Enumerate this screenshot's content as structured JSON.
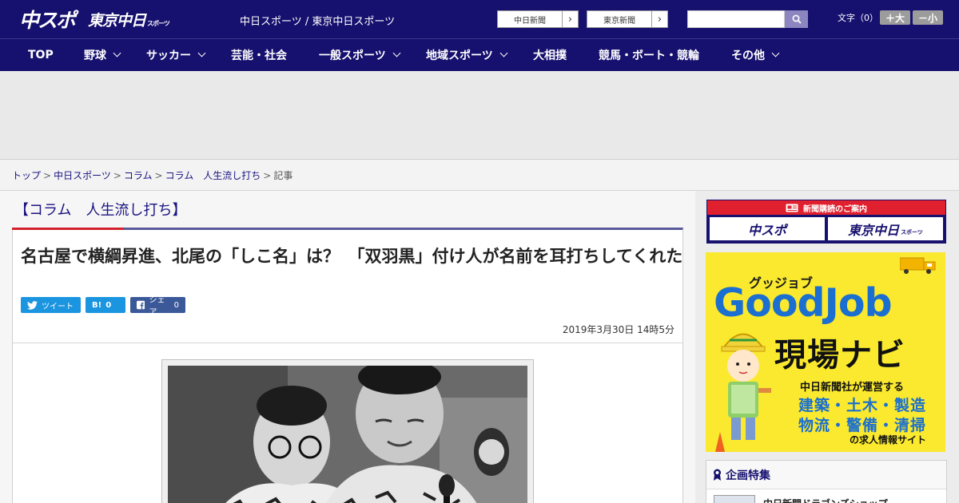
{
  "header": {
    "logo_main": "中スポ",
    "logo_tokyo": "東京中日",
    "logo_tokyo_small": "スポーツ",
    "site_title": "中日スポーツ / 東京中日スポーツ",
    "links": [
      {
        "label": "中日新聞"
      },
      {
        "label": "東京新聞"
      }
    ],
    "search": {
      "placeholder": ""
    },
    "font_size_label": "文字（0）",
    "font_large": "＋大",
    "font_small": "－小"
  },
  "nav": {
    "items": [
      {
        "label": "TOP",
        "has_menu": false
      },
      {
        "label": "野球",
        "has_menu": true
      },
      {
        "label": "サッカー",
        "has_menu": true
      },
      {
        "label": "芸能・社会",
        "has_menu": false
      },
      {
        "label": "一般スポーツ",
        "has_menu": true
      },
      {
        "label": "地域スポーツ",
        "has_menu": true
      },
      {
        "label": "大相撲",
        "has_menu": false
      },
      {
        "label": "競馬・ボート・競輪",
        "has_menu": false
      },
      {
        "label": "その他",
        "has_menu": true
      }
    ]
  },
  "breadcrumb": {
    "items": [
      "トップ",
      "中日スポーツ",
      "コラム",
      "コラム　人生流し打ち"
    ],
    "current": "記事",
    "separator": ">"
  },
  "article": {
    "column_label": "【コラム　人生流し打ち】",
    "headline": "名古屋で横綱昇進、北尾の「しこ名」は？　「双羽黒」付け人が名前を耳打ちしてくれた",
    "share": {
      "tweet_label": "ツイート",
      "hatena_label": "B!",
      "hatena_count": "0",
      "facebook_label": "シェア",
      "facebook_count": "0"
    },
    "date": "2019年3月30日 14時5分"
  },
  "sidebar": {
    "promo_heading": "新聞購読のご案内",
    "promo_logos": [
      {
        "label": "中スポ",
        "small": ""
      },
      {
        "label": "東京中日",
        "small": "スポーツ"
      }
    ],
    "goodjob": {
      "kana": "グッジョブ",
      "title": "GoodJob",
      "subtitle": "現場ナビ",
      "description": "中日新聞社が運営する",
      "categories_1": "建築・土木・製造",
      "categories_2": "物流・警備・清掃",
      "footer": "の求人情報サイト"
    },
    "feature_heading": "企画特集",
    "feature_item": "中日新聞ドラゴンズショップ"
  },
  "colors": {
    "header_bg": "#16106e",
    "accent_red": "#d4202c",
    "goodjob_yellow": "#fae92e",
    "goodjob_blue": "#1a6fd0",
    "twitter_blue": "#1b95e0",
    "facebook_blue": "#3b5998"
  }
}
